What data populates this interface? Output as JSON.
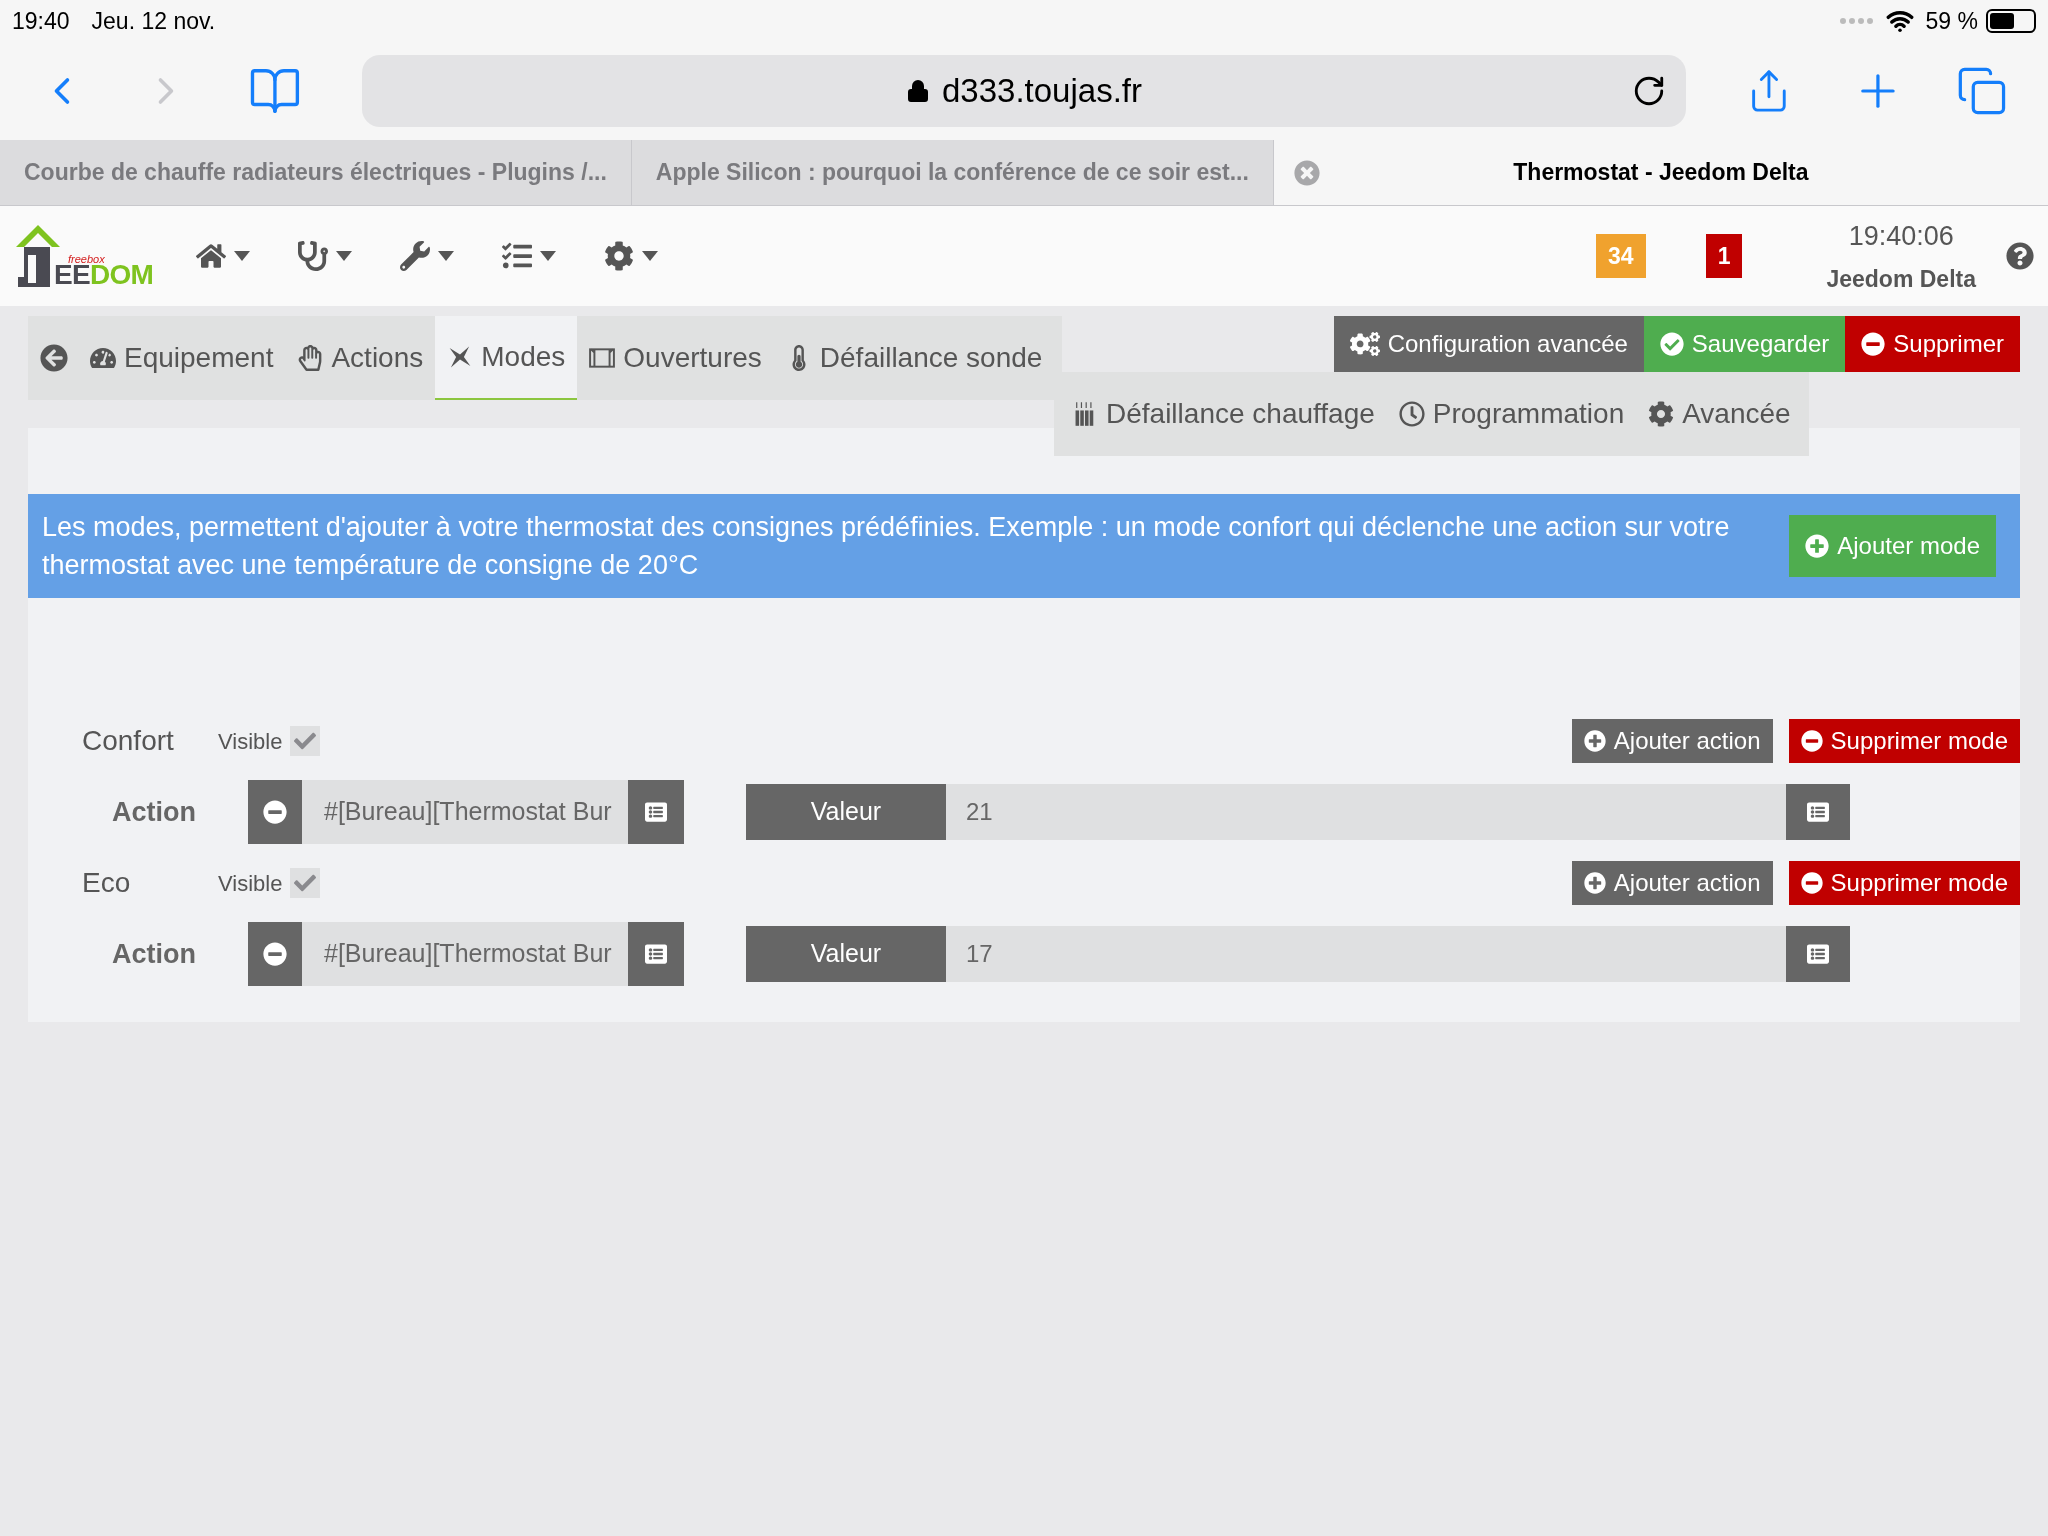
{
  "status_bar": {
    "time": "19:40",
    "date": "Jeu. 12 nov.",
    "battery": "59 %"
  },
  "browser": {
    "url": "d333.toujas.fr",
    "tabs": [
      {
        "title": "Courbe de chauffe radiateurs électriques - Plugins /...",
        "selected": false
      },
      {
        "title": "Apple Silicon : pourquoi la conférence de ce soir est...",
        "selected": false
      },
      {
        "title": "Thermostat - Jeedom Delta",
        "selected": true
      }
    ]
  },
  "navbar": {
    "logo": {
      "tagline": "freebox",
      "letters": "EEDOM"
    },
    "badges": [
      {
        "count": "34",
        "color": "#f0a22e"
      },
      {
        "count": "1",
        "color": "#c00000"
      }
    ],
    "clock": "19:40:06",
    "site_name": "Jeedom Delta"
  },
  "tabs": [
    {
      "label": "Equipement",
      "selected": false
    },
    {
      "label": "Actions",
      "selected": false
    },
    {
      "label": "Modes",
      "selected": true
    },
    {
      "label": "Ouvertures",
      "selected": false
    },
    {
      "label": "Défaillance sonde",
      "selected": false
    },
    {
      "label": "Défaillance chauffage",
      "selected": false
    },
    {
      "label": "Programmation",
      "selected": false
    },
    {
      "label": "Avancée",
      "selected": false
    }
  ],
  "actions": [
    {
      "label": "Configuration avancée",
      "kind": "config"
    },
    {
      "label": "Sauvegarder",
      "kind": "save"
    },
    {
      "label": "Supprimer",
      "kind": "delete"
    }
  ],
  "info": {
    "text": "Les modes, permettent d'ajouter à votre thermostat des consignes prédéfinies. Exemple : un mode confort qui déclenche une action sur votre thermostat avec une température de consigne de 20°C",
    "add_mode": "Ajouter mode"
  },
  "modes": [
    {
      "name": "Confort",
      "visible_label": "Visible",
      "visible": true,
      "add_action": "Ajouter action",
      "delete_mode": "Supprimer mode",
      "actions": [
        {
          "label": "Action",
          "command": "#[Bureau][Thermostat Bur",
          "value_label": "Valeur",
          "value": "21"
        }
      ]
    },
    {
      "name": "Eco",
      "visible_label": "Visible",
      "visible": true,
      "add_action": "Ajouter action",
      "delete_mode": "Supprimer mode",
      "actions": [
        {
          "label": "Action",
          "command": "#[Bureau][Thermostat Bur",
          "value_label": "Valeur",
          "value": "17"
        }
      ]
    }
  ]
}
